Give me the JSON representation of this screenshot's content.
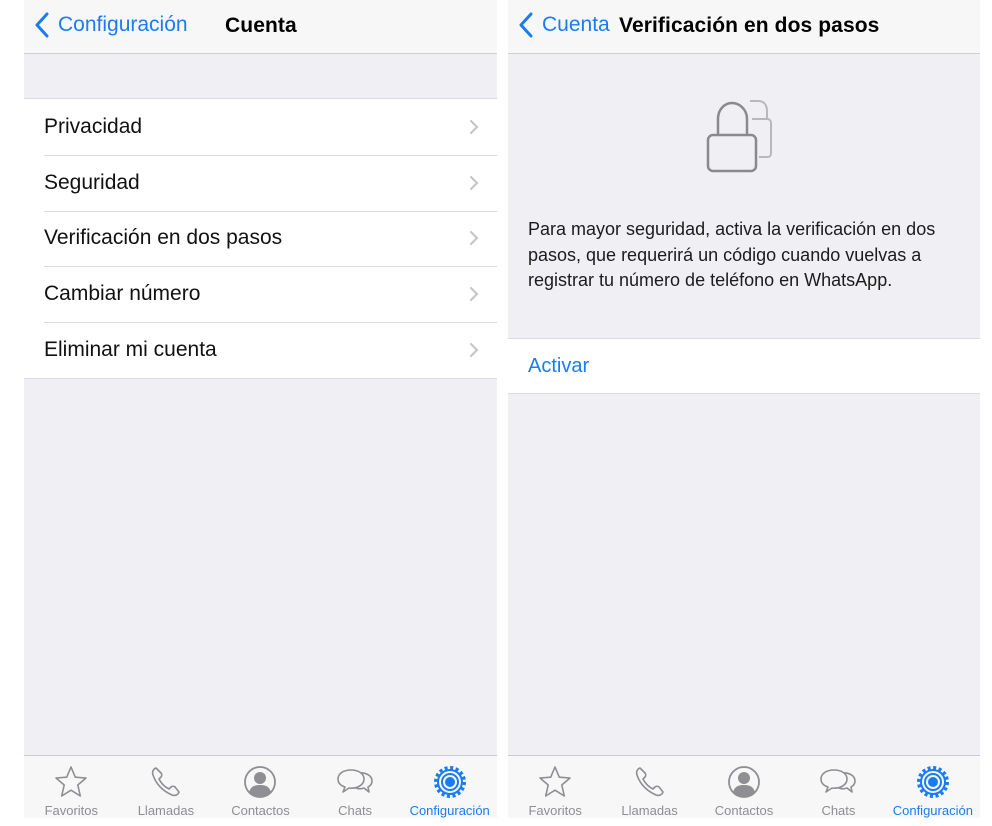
{
  "left": {
    "navbar": {
      "back_label": "Configuración",
      "title": "Cuenta"
    },
    "items": [
      {
        "label": "Privacidad"
      },
      {
        "label": "Seguridad"
      },
      {
        "label": "Verificación en dos pasos"
      },
      {
        "label": "Cambiar número"
      },
      {
        "label": "Eliminar mi cuenta"
      }
    ]
  },
  "right": {
    "navbar": {
      "back_label": "Cuenta",
      "title": "Verificación en dos pasos"
    },
    "icon": "lock-icon",
    "description": "Para mayor seguridad, activa la verificación en dos pasos, que requerirá un código cuando vuelvas a registrar tu número de teléfono en WhatsApp.",
    "action_label": "Activar"
  },
  "tabbar": {
    "active": "Configuración",
    "tabs": [
      {
        "label": "Favoritos",
        "icon": "star-icon"
      },
      {
        "label": "Llamadas",
        "icon": "phone-icon"
      },
      {
        "label": "Contactos",
        "icon": "contact-icon"
      },
      {
        "label": "Chats",
        "icon": "chat-bubbles-icon"
      },
      {
        "label": "Configuración",
        "icon": "gear-icon"
      }
    ]
  },
  "colors": {
    "accent": "#1a7cf2",
    "inactive": "#8e8e93",
    "background": "#efeff4"
  }
}
